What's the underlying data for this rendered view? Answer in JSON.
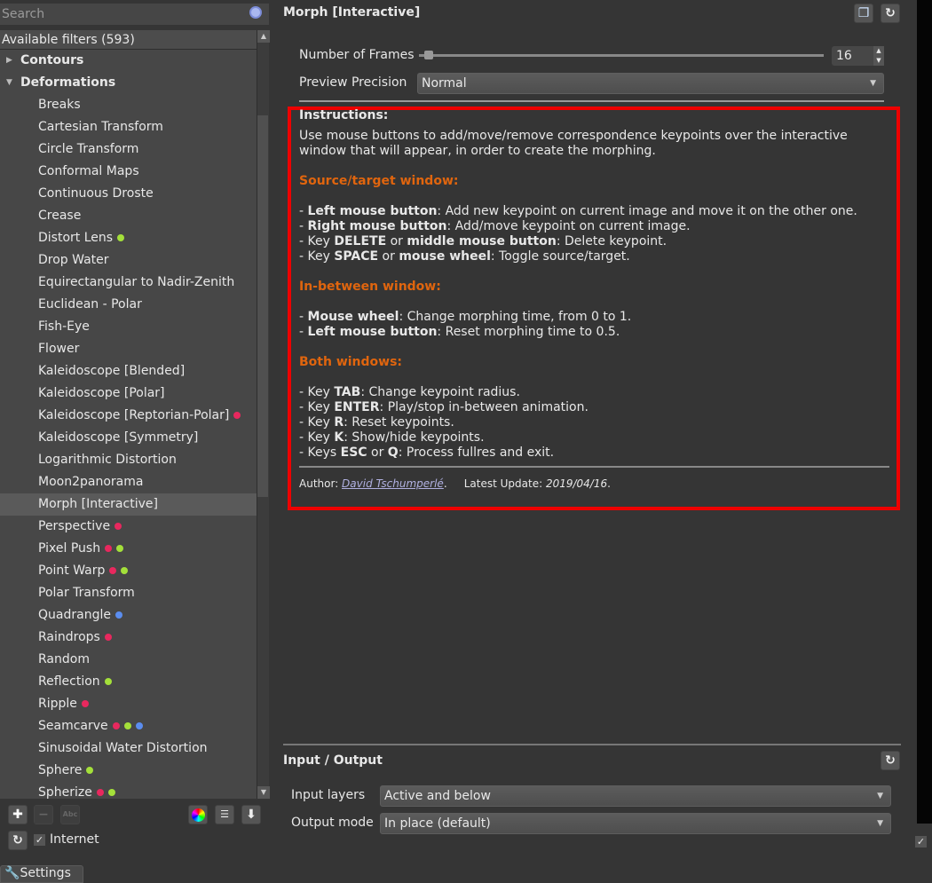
{
  "search": {
    "placeholder": "Search"
  },
  "filters": {
    "header": "Available filters (593)",
    "categories": [
      {
        "label": "Contours",
        "expanded": false
      },
      {
        "label": "Deformations",
        "expanded": true
      }
    ],
    "items": [
      {
        "label": "Breaks",
        "dots": []
      },
      {
        "label": "Cartesian Transform",
        "dots": []
      },
      {
        "label": "Circle Transform",
        "dots": []
      },
      {
        "label": "Conformal Maps",
        "dots": []
      },
      {
        "label": "Continuous Droste",
        "dots": []
      },
      {
        "label": "Crease",
        "dots": []
      },
      {
        "label": "Distort Lens",
        "dots": [
          "#a4e03a"
        ]
      },
      {
        "label": "Drop Water",
        "dots": []
      },
      {
        "label": "Equirectangular to Nadir-Zenith",
        "dots": []
      },
      {
        "label": "Euclidean - Polar",
        "dots": []
      },
      {
        "label": "Fish-Eye",
        "dots": []
      },
      {
        "label": "Flower",
        "dots": []
      },
      {
        "label": "Kaleidoscope [Blended]",
        "dots": []
      },
      {
        "label": "Kaleidoscope [Polar]",
        "dots": []
      },
      {
        "label": "Kaleidoscope [Reptorian-Polar]",
        "dots": [
          "#e8285e"
        ]
      },
      {
        "label": "Kaleidoscope [Symmetry]",
        "dots": []
      },
      {
        "label": "Logarithmic Distortion",
        "dots": []
      },
      {
        "label": "Moon2panorama",
        "dots": []
      },
      {
        "label": "Morph [Interactive]",
        "dots": [],
        "selected": true
      },
      {
        "label": "Perspective",
        "dots": [
          "#e8285e"
        ]
      },
      {
        "label": "Pixel Push",
        "dots": [
          "#e8285e",
          "#a4e03a"
        ]
      },
      {
        "label": "Point Warp",
        "dots": [
          "#e8285e",
          "#a4e03a"
        ]
      },
      {
        "label": "Polar Transform",
        "dots": []
      },
      {
        "label": "Quadrangle",
        "dots": [
          "#5b8def"
        ]
      },
      {
        "label": "Raindrops",
        "dots": [
          "#e8285e"
        ]
      },
      {
        "label": "Random",
        "dots": []
      },
      {
        "label": "Reflection",
        "dots": [
          "#a4e03a"
        ]
      },
      {
        "label": "Ripple",
        "dots": [
          "#e8285e"
        ]
      },
      {
        "label": "Seamcarve",
        "dots": [
          "#e8285e",
          "#a4e03a",
          "#5b8def"
        ]
      },
      {
        "label": "Sinusoidal Water Distortion",
        "dots": []
      },
      {
        "label": "Sphere",
        "dots": [
          "#a4e03a"
        ]
      },
      {
        "label": "Spherize",
        "dots": [
          "#e8285e",
          "#a4e03a"
        ]
      }
    ]
  },
  "bottom": {
    "internet_label": "Internet",
    "internet_checked": true,
    "settings_tab": "Settings"
  },
  "panel": {
    "title": "Morph [Interactive]",
    "frames_label": "Number of Frames",
    "frames_value": "16",
    "precision_label": "Preview Precision",
    "precision_value": "Normal",
    "instructions_title": "Instructions:",
    "intro": "Use mouse buttons to add/move/remove correspondence keypoints over the interactive window that will appear, in order to create the morphing.",
    "sections": [
      {
        "title": "Source/target window:",
        "lines": [
          [
            "- ",
            "Left mouse button",
            ": Add new keypoint on current image and move it on the other one."
          ],
          [
            "- ",
            "Right mouse button",
            ": Add/move keypoint on current image."
          ],
          [
            "- Key ",
            "DELETE",
            " or ",
            "middle mouse button",
            ": Delete keypoint."
          ],
          [
            "- Key ",
            "SPACE",
            " or ",
            "mouse wheel",
            ": Toggle source/target."
          ]
        ]
      },
      {
        "title": "In-between window:",
        "lines": [
          [
            "- ",
            "Mouse wheel",
            ": Change morphing time, from 0 to 1."
          ],
          [
            "- ",
            "Left mouse button",
            ": Reset morphing time to 0.5."
          ]
        ]
      },
      {
        "title": "Both windows:",
        "lines": [
          [
            "- Key ",
            "TAB",
            ": Change keypoint radius."
          ],
          [
            "- Key ",
            "ENTER",
            ": Play/stop in-between animation."
          ],
          [
            "- Key ",
            "R",
            ": Reset keypoints."
          ],
          [
            "- Key ",
            "K",
            ": Show/hide keypoints."
          ],
          [
            "- Keys ",
            "ESC",
            " or ",
            "Q",
            ": Process fullres and exit."
          ]
        ]
      }
    ],
    "author_label": "Author: ",
    "author_name": "David Tschumperlé",
    "update_label": "Latest Update: ",
    "update_value": "2019/04/16"
  },
  "io": {
    "title": "Input / Output",
    "input_label": "Input layers",
    "input_value": "Active and below",
    "output_label": "Output mode",
    "output_value": "In place (default)"
  },
  "colors": {
    "accent_orange": "#e0650e",
    "highlight_red": "#ee0000"
  }
}
